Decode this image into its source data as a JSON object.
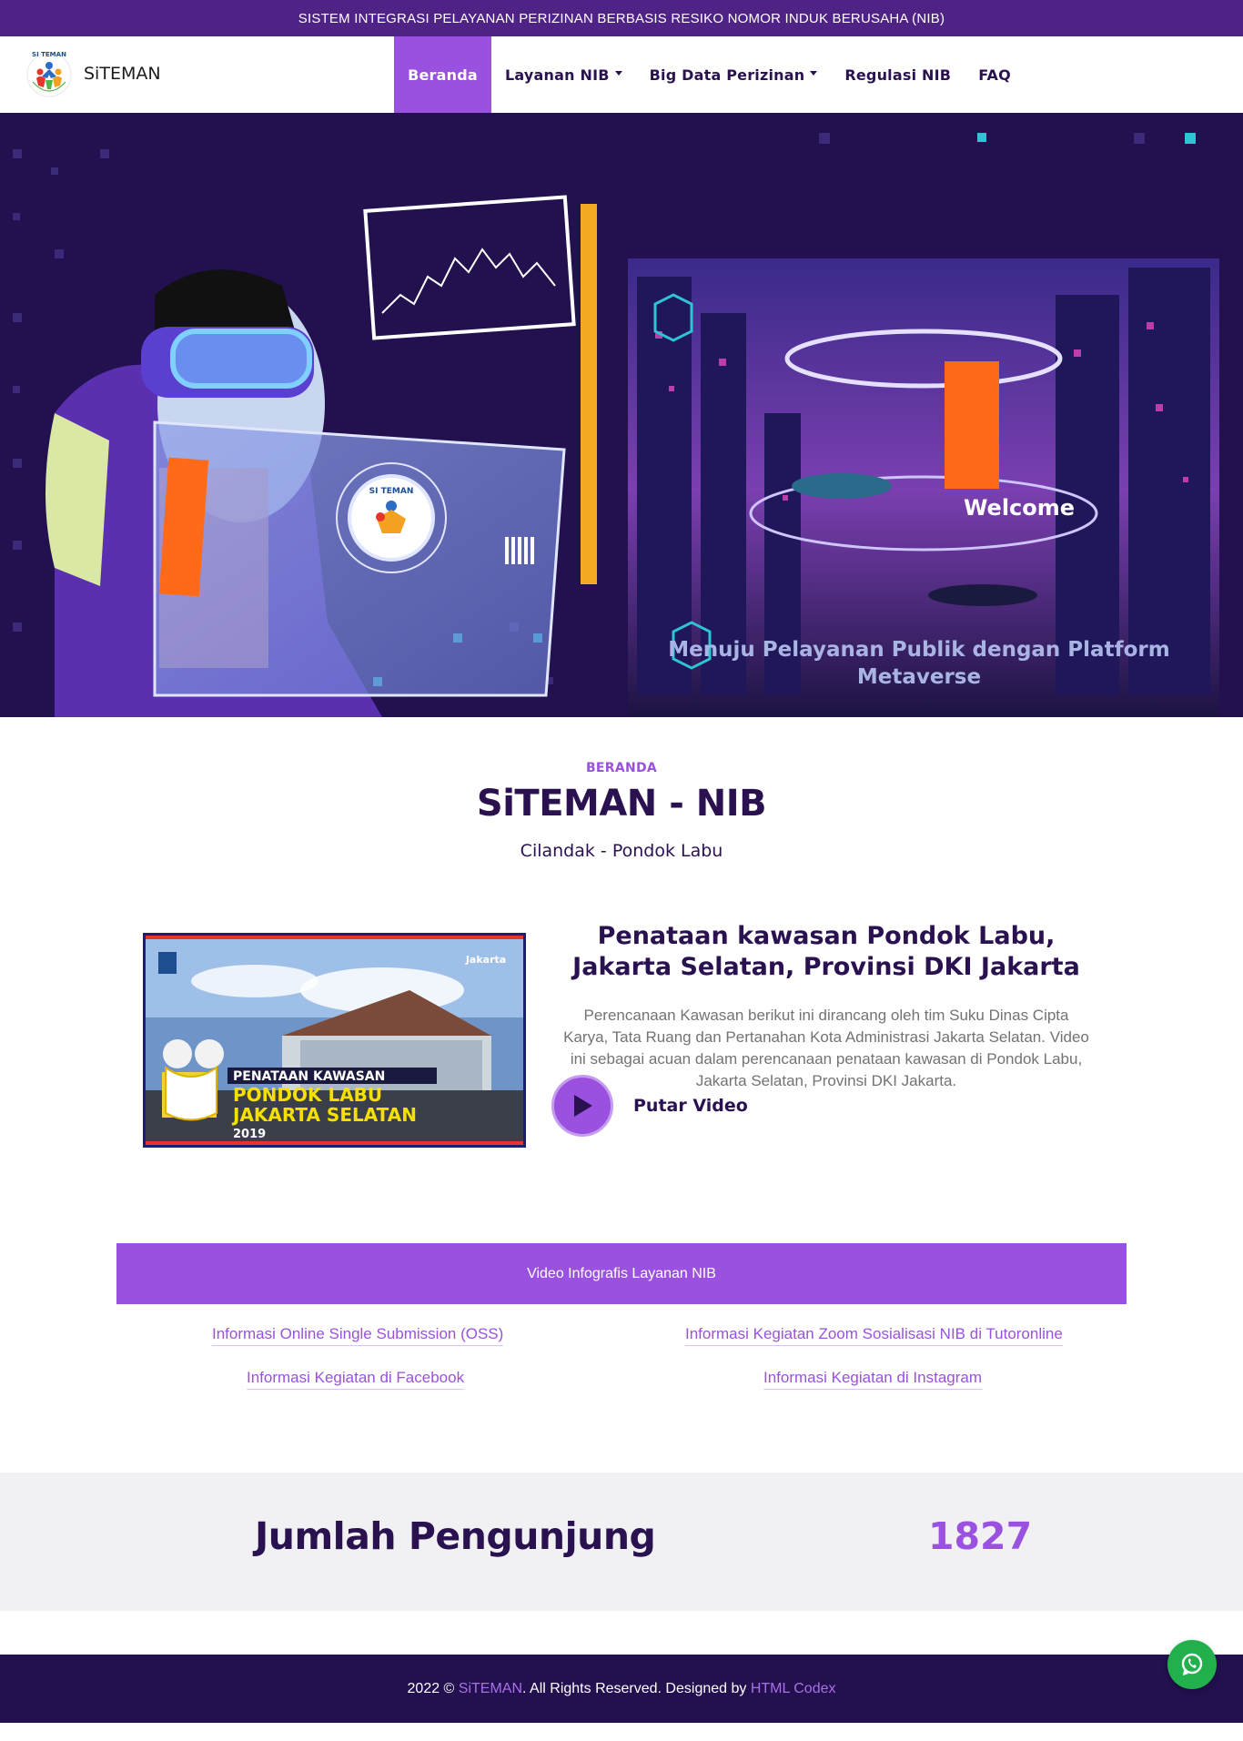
{
  "topbar": {
    "text": "SISTEM INTEGRASI PELAYANAN PERIZINAN BERBASIS RESIKO NOMOR INDUK BERUSAHA (NIB)"
  },
  "brand": {
    "name": "SiTEMAN",
    "logo_icon": "siteman-logo"
  },
  "nav": {
    "items": [
      {
        "label": "Beranda",
        "active": true,
        "dropdown": false
      },
      {
        "label": "Layanan NIB",
        "active": false,
        "dropdown": true
      },
      {
        "label": "Big Data Perizinan",
        "active": false,
        "dropdown": true
      },
      {
        "label": "Regulasi NIB",
        "active": false,
        "dropdown": false
      },
      {
        "label": "FAQ",
        "active": false,
        "dropdown": false
      }
    ]
  },
  "hero": {
    "caption_line1": "Menuju Pelayanan Publik dengan Platform",
    "caption_line2": "Metaverse",
    "screen_logo_text": "SI TEMAN",
    "city_sign": "Welcome"
  },
  "section": {
    "label": "BERANDA",
    "title": "SiTEMAN - NIB",
    "subtitle": "Cilandak - Pondok Labu"
  },
  "feature": {
    "title": "Penataan kawasan Pondok Labu, Jakarta Selatan, Provinsi DKI Jakarta",
    "description": "Perencanaan Kawasan berikut ini dirancang oleh tim Suku Dinas Cipta Karya, Tata Ruang dan Pertanahan Kota Administrasi Jakarta Selatan. Video ini sebagai acuan dalam perencanaan penataan kawasan di Pondok Labu, Jakarta Selatan, Provinsi DKI Jakarta.",
    "play_label": "Putar Video",
    "thumb": {
      "line1": "PENATAAN KAWASAN",
      "line2": "PONDOK LABU",
      "line3": "JAKARTA SELATAN",
      "year": "2019",
      "badge": "Jakarta"
    }
  },
  "infografis": {
    "bar_label": "Video Infografis Layanan NIB",
    "links": [
      "Informasi Online Single Submission (OSS)",
      "Informasi Kegiatan Zoom Sosialisasi NIB di Tutoronline",
      "Informasi Kegiatan di Facebook",
      "Informasi Kegiatan di Instagram"
    ]
  },
  "counter": {
    "label": "Jumlah Pengunjung",
    "value": "1827"
  },
  "footer": {
    "prefix": "2022 © ",
    "brand": "SiTEMAN",
    "middle": ". All Rights Reserved. Designed by ",
    "designer": "HTML Codex",
    "whatsapp_icon": "whatsapp-icon"
  }
}
